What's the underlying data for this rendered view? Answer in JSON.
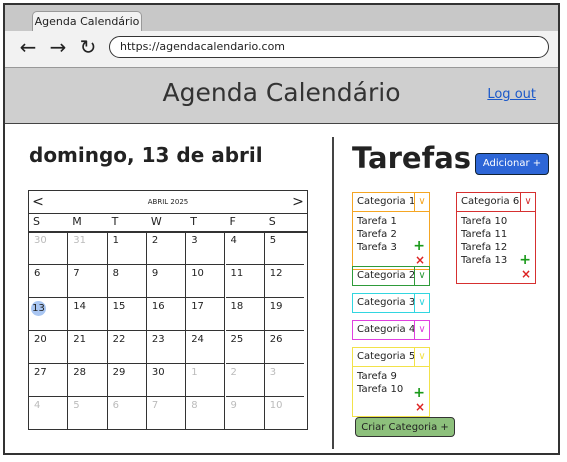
{
  "browser": {
    "tab_title": "Agenda Calendário",
    "url": "https://agendacalendario.com"
  },
  "header": {
    "title": "Agenda Calendário",
    "logout": "Log out"
  },
  "date_title": "domingo, 13 de abril",
  "calendar": {
    "month": "ABRIL 2025",
    "prev": "<",
    "next": ">",
    "weekdays": [
      "S",
      "M",
      "T",
      "W",
      "T",
      "F",
      "S"
    ],
    "weeks": [
      [
        "30",
        "31",
        "1",
        "2",
        "3",
        "4",
        "5"
      ],
      [
        "6",
        "7",
        "8",
        "9",
        "10",
        "11",
        "12"
      ],
      [
        "13",
        "14",
        "15",
        "16",
        "17",
        "18",
        "19"
      ],
      [
        "20",
        "21",
        "22",
        "23",
        "24",
        "25",
        "26"
      ],
      [
        "27",
        "28",
        "29",
        "30",
        "1",
        "2",
        "3"
      ],
      [
        "4",
        "5",
        "6",
        "7",
        "8",
        "9",
        "10"
      ]
    ],
    "today": "13"
  },
  "tasks_panel": {
    "title": "Tarefas",
    "add_button": "Adicionar +",
    "create_category": "Criar Categoria +",
    "chevron": "∨",
    "plus": "+",
    "cross": "×",
    "categories": [
      {
        "name": "Categoria 1",
        "color": "#f5a623",
        "tasks": [
          "Tarefa 1",
          "Tarefa 2",
          "Tarefa 3"
        ]
      },
      {
        "name": "Categoria 2",
        "color": "#2e9b3a",
        "tasks": []
      },
      {
        "name": "Categoria 3",
        "color": "#32d6e0",
        "tasks": []
      },
      {
        "name": "Categoria 4",
        "color": "#e040e0",
        "tasks": []
      },
      {
        "name": "Categoria 5",
        "color": "#f2e24a",
        "tasks": [
          "Tarefa 9",
          "Tarefa 10"
        ]
      },
      {
        "name": "Categoria 6",
        "color": "#d63030",
        "tasks": [
          "Tarefa 10",
          "Tarefa 11",
          "Tarefa 12",
          "Tarefa 13"
        ]
      }
    ]
  }
}
